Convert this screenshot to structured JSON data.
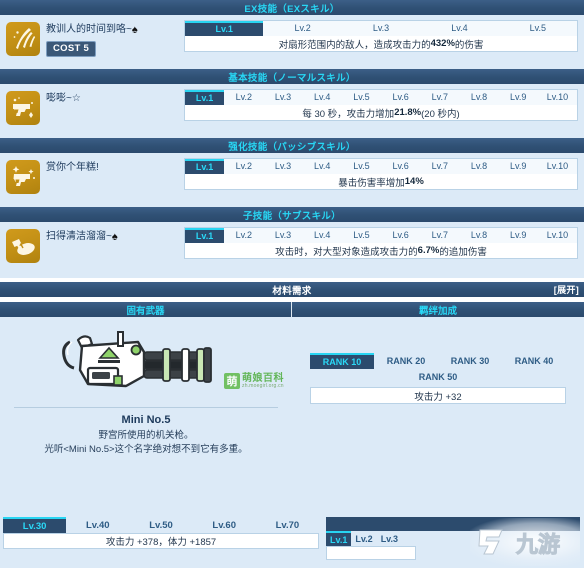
{
  "sections": {
    "ex": {
      "header": "EX技能（EXスキル）",
      "skill_name": "教训人的时间到咯~",
      "suit_symbol": "♠",
      "cost": "COST 5",
      "icon": "slash-burst-icon",
      "levels": [
        "Lv.1",
        "Lv.2",
        "Lv.3",
        "Lv.4",
        "Lv.5"
      ],
      "active_level": "Lv.1",
      "desc_pre": "对扇形范围内的敌人，造成攻击力的 ",
      "desc_value": "432%",
      "desc_post": " 的伤害"
    },
    "normal": {
      "header": "基本技能（ノーマルスキル）",
      "skill_name": "嘭嘭~☆",
      "icon": "pistol-icon",
      "levels": [
        "Lv.1",
        "Lv.2",
        "Lv.3",
        "Lv.4",
        "Lv.5",
        "Lv.6",
        "Lv.7",
        "Lv.8",
        "Lv.9",
        "Lv.10"
      ],
      "active_level": "Lv.1",
      "desc_pre": "每 30 秒，攻击力增加 ",
      "desc_value": "21.8%",
      "desc_post": " (20 秒内)"
    },
    "passive": {
      "header": "强化技能（パッシブスキル）",
      "skill_name": "赏你个年糕!",
      "icon": "pistol-sparkle-icon",
      "levels": [
        "Lv.1",
        "Lv.2",
        "Lv.3",
        "Lv.4",
        "Lv.5",
        "Lv.6",
        "Lv.7",
        "Lv.8",
        "Lv.9",
        "Lv.10"
      ],
      "active_level": "Lv.1",
      "desc_pre": "暴击伤害率增加 ",
      "desc_value": "14%",
      "desc_post": ""
    },
    "sub": {
      "header": "子技能（サブスキル）",
      "skill_name": "扫得清洁溜溜~",
      "suit_symbol": "♠",
      "icon": "broom-icon",
      "levels": [
        "Lv.1",
        "Lv.2",
        "Lv.3",
        "Lv.4",
        "Lv.5",
        "Lv.6",
        "Lv.7",
        "Lv.8",
        "Lv.9",
        "Lv.10"
      ],
      "active_level": "Lv.1",
      "desc_pre": "攻击时，对大型对象造成攻击力的 ",
      "desc_value": "6.7%",
      "desc_post": " 的追加伤害"
    }
  },
  "materials": {
    "header": "材料需求",
    "expand_label": "[展开]"
  },
  "weapon": {
    "column_header": "固有武器",
    "name": "Mini No.5",
    "desc_line1": "野宫所使用的机关枪。",
    "desc_line2": "光听<Mini No.5>这个名字绝对想不到它有多重。",
    "levels": [
      "Lv.30",
      "Lv.40",
      "Lv.50",
      "Lv.60",
      "Lv.70"
    ],
    "active_level": "Lv.30",
    "stats": "攻击力 +378，体力 +1857"
  },
  "bond": {
    "column_header": "羁绊加成",
    "ranks_row1": [
      "RANK 10",
      "RANK 20",
      "RANK 30",
      "RANK 40"
    ],
    "ranks_row2": [
      "RANK 50"
    ],
    "active_rank": "RANK 10",
    "stats": "攻击力 +32",
    "mini_levels": [
      "Lv.1",
      "Lv.2",
      "Lv.3"
    ],
    "mini_active": "Lv.1"
  },
  "watermarks": {
    "moegirl_char": "萌",
    "moegirl_name": "萌娘百科",
    "moegirl_url": "zh.moegirl.org.cn",
    "ninegame": "九游"
  },
  "colors": {
    "header_bg": "#2f5074",
    "header_text": "#28d7f5",
    "panel_bg": "#dceaf7",
    "active_tab_bg": "#2c4b6d",
    "active_tab_text": "#2ad9f7",
    "accent_top": "#28d5f2",
    "icon_gold": "#c18f15",
    "text_navy": "#1d3a5c"
  }
}
